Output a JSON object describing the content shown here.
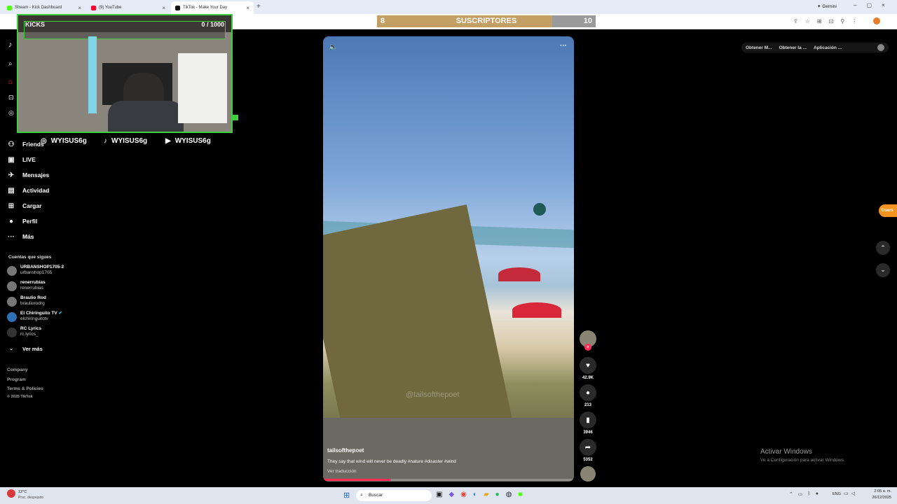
{
  "browser": {
    "tabs": [
      {
        "label": "Stream - Kick Dashboard",
        "color": "#53fc18"
      },
      {
        "label": "(9) YouTube",
        "color": "#ff0033"
      },
      {
        "label": "TikTok - Make Your Day",
        "color": "#111111"
      }
    ],
    "gemini_label": "Gemini"
  },
  "subscribers": {
    "current": "8",
    "label": "SUSCRIPTORES",
    "goal": "10",
    "progress": 0.8
  },
  "sidebar": {
    "items": [
      {
        "label": "Friends",
        "icon": "friends-icon"
      },
      {
        "label": "LIVE",
        "icon": "live-icon"
      },
      {
        "label": "Mensajes",
        "icon": "messages-icon"
      },
      {
        "label": "Actividad",
        "icon": "activity-icon"
      },
      {
        "label": "Cargar",
        "icon": "upload-icon"
      },
      {
        "label": "Perfil",
        "icon": "profile-icon"
      },
      {
        "label": "Más",
        "icon": "more-icon"
      }
    ],
    "following_title": "Cuentas que sigues",
    "accounts": [
      {
        "name": "URBANSHOP1705-2",
        "handle": "urbanshop1705"
      },
      {
        "name": "renerrubias",
        "handle": "renerrubias"
      },
      {
        "name": "Braulio Rod",
        "handle": "brauliorodrg"
      },
      {
        "name": "El Chiringuito TV",
        "handle": "elchiringuitotv"
      },
      {
        "name": "RC Lyrics",
        "handle": "rc.lyrics_"
      }
    ],
    "see_more": "Ver más",
    "footer": [
      "Company",
      "Program",
      "Terms & Policies",
      "© 2025 TikTok"
    ]
  },
  "webcam": {
    "overlay_label": "KICKS",
    "counter": "0 / 1000"
  },
  "socials": [
    {
      "platform": "instagram",
      "handle": "WYISUS6g"
    },
    {
      "platform": "tiktok",
      "handle": "WYISUS6g"
    },
    {
      "platform": "youtube",
      "handle": "WYISUS6g"
    }
  ],
  "top_right": [
    "Obtener M...",
    "Obtener la ...",
    "Aplicación ..."
  ],
  "video": {
    "author": "tailsofthepoet",
    "caption": "They say that wind will never be deadly #nature #disaster #wind",
    "translate": "Ver traducción",
    "watermark": "@tailsofthepoet",
    "progress": 0.27
  },
  "actions": {
    "likes": "42.9K",
    "comments": "213",
    "saves": "3946",
    "shares": "5352"
  },
  "users_badge": "Users",
  "activation": {
    "title": "Activar Windows",
    "subtitle": "Ve a Configuración para activar Windows."
  },
  "taskbar": {
    "weather_temp": "12°C",
    "weather_desc": "Prac. despejado",
    "search": "Buscar",
    "lang": "ENG",
    "time": "2:05 a. m.",
    "date": "26/12/2025"
  }
}
